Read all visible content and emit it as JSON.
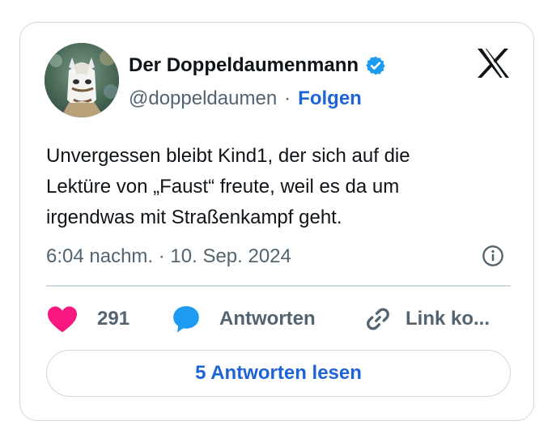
{
  "author": {
    "display_name": "Der Doppeldaumenmann",
    "handle": "@doppeldaumen",
    "separator": "·",
    "follow_label": "Folgen"
  },
  "tweet": {
    "lines": [
      "Unvergessen bleibt Kind1, der sich auf die",
      "Lektüre von „Faust“ freute, weil es da um",
      "irgendwas mit Straßenkampf geht."
    ],
    "timestamp": "6:04 nachm. · 10. Sep. 2024"
  },
  "actions": {
    "like_count": "291",
    "reply_label": "Antworten",
    "link_label": "Link ko..."
  },
  "read_replies_label": "5 Antworten lesen",
  "icons": {
    "brand": "x-logo-icon",
    "verified": "verified-badge-icon",
    "info": "info-icon",
    "like": "heart-icon",
    "reply": "speech-bubble-icon",
    "link": "link-icon"
  },
  "colors": {
    "accent": "#1d64d6",
    "verified": "#1d9bf0",
    "heart": "#f91880",
    "secondary_text": "#536471",
    "border": "#cfd9de"
  }
}
